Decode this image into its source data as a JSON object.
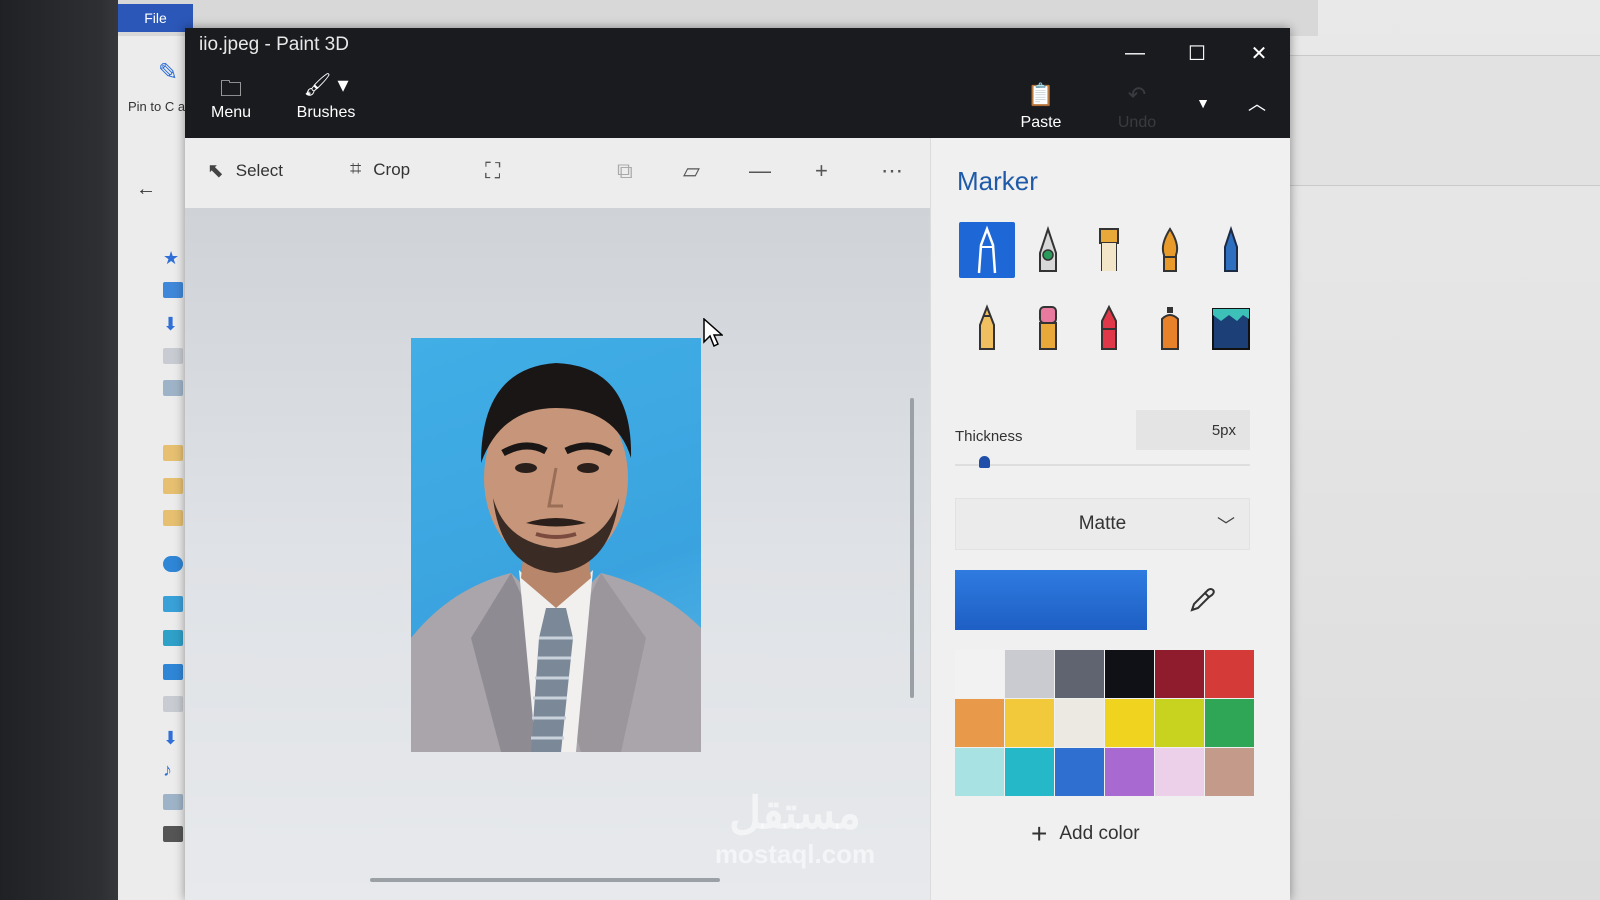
{
  "explorer": {
    "file_tab": "File",
    "pin_label": "Pin to C acce"
  },
  "window": {
    "title": "iio.jpeg - Paint 3D"
  },
  "ribbon": {
    "menu": "Menu",
    "brushes": "Brushes",
    "paste": "Paste",
    "undo": "Undo"
  },
  "toolbar": {
    "select": "Select",
    "crop": "Crop"
  },
  "panel": {
    "title": "Marker",
    "thickness_label": "Thickness",
    "thickness_value": "5px",
    "thickness_level": 0.05,
    "finish": "Matte",
    "add_color": "Add color",
    "current_color": "#2a6fd8",
    "palette": [
      "#f2f2f2",
      "#c9cbd0",
      "#5f6470",
      "#0f1116",
      "#8e1c2c",
      "#d43a37",
      "#e8994a",
      "#f2c93a",
      "#ece8e2",
      "#f0d31e",
      "#c8d320",
      "#2fa655",
      "#a8e2e2",
      "#25b8c8",
      "#2f6fd0",
      "#a86ad0",
      "#ecd0ea",
      "#c49a8a"
    ]
  },
  "watermark": {
    "arabic": "مستقل",
    "latin": "mostaql.com"
  }
}
